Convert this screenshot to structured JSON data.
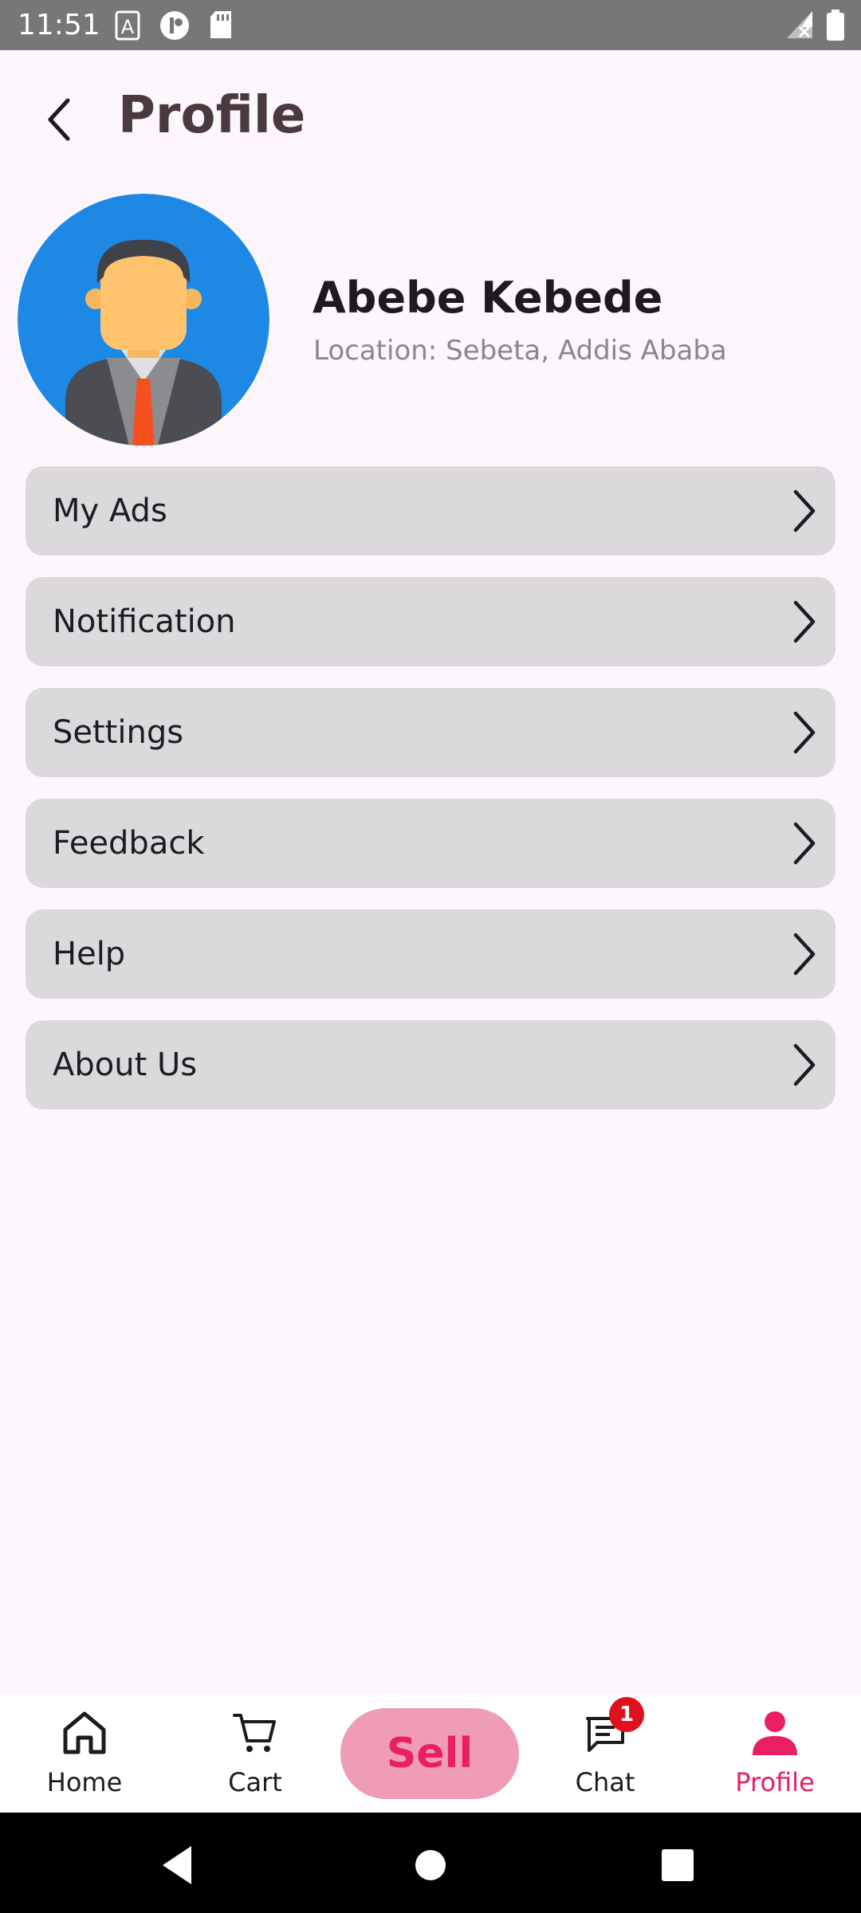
{
  "status_bar": {
    "time": "11:51",
    "icons": [
      "text-a-icon",
      "circle-app-icon",
      "sd-card-icon",
      "signal-off-icon",
      "battery-icon"
    ]
  },
  "header": {
    "title": "Profile",
    "back_icon": "chevron-left-icon"
  },
  "profile": {
    "name": "Abebe Kebede",
    "location": "Location: Sebeta, Addis Ababa",
    "avatar_icon": "person-avatar-icon"
  },
  "menu": {
    "items": [
      {
        "label": "My Ads"
      },
      {
        "label": "Notification"
      },
      {
        "label": "Settings"
      },
      {
        "label": "Feedback"
      },
      {
        "label": "Help"
      },
      {
        "label": "About Us"
      }
    ]
  },
  "bottom_nav": {
    "home": "Home",
    "cart": "Cart",
    "sell": "Sell",
    "chat": "Chat",
    "chat_badge": "1",
    "profile": "Profile",
    "active": "profile"
  },
  "colors": {
    "background": "#fdf7fd",
    "accent": "#e91e63",
    "sell_bg": "#ee9db4",
    "menu_item_bg": "#dcd9dd",
    "avatar_bg": "#1e88e5",
    "badge": "#e0101f"
  }
}
